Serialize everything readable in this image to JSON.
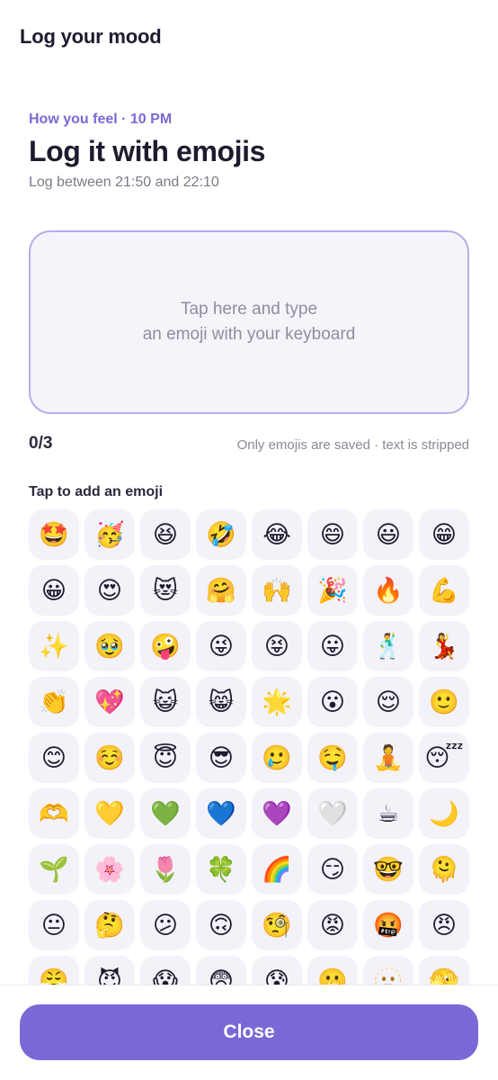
{
  "header": {
    "title": "Log your mood"
  },
  "prompt": {
    "eyebrow": "How you feel · 10 PM",
    "title": "Log it with emojis",
    "window": "Log between 21:50 and 22:10"
  },
  "input": {
    "placeholder_line1": "Tap here and type",
    "placeholder_line2": "an emoji with your keyboard",
    "count": "0/3",
    "hint": "Only emojis are saved · text is stripped"
  },
  "picker": {
    "label": "Tap to add an emoji",
    "emojis": [
      "🤩",
      "🥳",
      "😆",
      "🤣",
      "😂",
      "😄",
      "😃",
      "😁",
      "😀",
      "😍",
      "😻",
      "🤗",
      "🙌",
      "🎉",
      "🔥",
      "💪",
      "✨",
      "🥹",
      "🤪",
      "😜",
      "😝",
      "😛",
      "🕺",
      "💃",
      "👏",
      "💖",
      "😺",
      "😸",
      "🌟",
      "😮",
      "😌",
      "🙂",
      "😊",
      "☺️",
      "😇",
      "😎",
      "🥲",
      "🤤",
      "🧘",
      "😴",
      "🫶",
      "💛",
      "💚",
      "💙",
      "💜",
      "🤍",
      "☕",
      "🌙",
      "🌱",
      "🌸",
      "🌷",
      "🍀",
      "🌈",
      "😏",
      "🤓",
      "🫠",
      "😐",
      "🤔",
      "😕",
      "🙃",
      "🧐",
      "😡",
      "🤬",
      "😠",
      "😤",
      "😈",
      "😱",
      "😨",
      "😰",
      "🫢",
      "🫥",
      "🫣"
    ]
  },
  "footer": {
    "close_label": "Close"
  }
}
